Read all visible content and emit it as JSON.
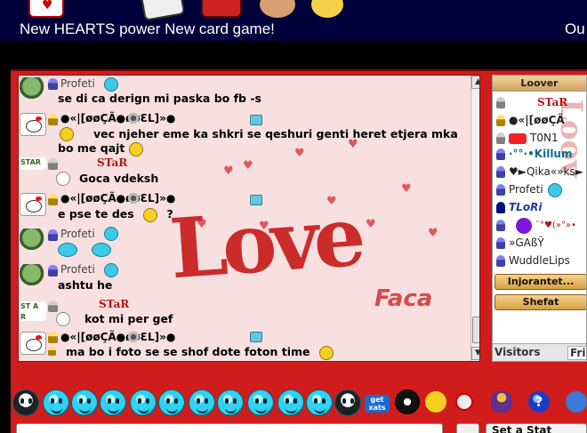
{
  "banner": {
    "text": "New HEARTS power New card game!",
    "text_right": "Ou"
  },
  "chat": {
    "background_text": "Love",
    "background_text2": "Faca",
    "messages": [
      {
        "name": "Profeti",
        "text": "se di ca derign mi paska bo fb -s"
      },
      {
        "name": "●«|[øøÇÃ●øøƐL]»●",
        "text": "vec njeher eme ka shkri se qeshuri genti heret etjera mka",
        "text2": "bo me qajt"
      },
      {
        "name": "STaR",
        "text": "Goca vdeksh"
      },
      {
        "name": "●«|[øøÇÃ●øøƐL]»●",
        "text": "e pse te des",
        "text_suffix": "?"
      },
      {
        "name": "Profeti",
        "text": ""
      },
      {
        "name": "Profeti",
        "text": "ashtu he"
      },
      {
        "name": "STaR",
        "text": "kot mi per gef"
      },
      {
        "name": "●«|[øøÇÃ●øøƐL]»●",
        "text": "ma bo i foto se se shof dote foton time"
      }
    ]
  },
  "userlist": {
    "header": "Loover",
    "users": [
      {
        "name": "STaR"
      },
      {
        "name": "●«|[øøÇÃ"
      },
      {
        "name": "T0N1"
      },
      {
        "name": "·°°·•Killum"
      },
      {
        "name": "♥►Qika«»ks►"
      },
      {
        "name": "Profeti"
      },
      {
        "name": "TLoRi"
      },
      {
        "name": "¨°♥(»°»•"
      },
      {
        "name": "»GAßŸ"
      },
      {
        "name": "WuddleLips"
      }
    ],
    "buttons": [
      "Injorantet...",
      "Shefat"
    ],
    "tabs": [
      "Visitors",
      "Frie"
    ]
  },
  "toolbar": {
    "get_xats": "get xats"
  },
  "input": {
    "status_label": "Set a Stat"
  }
}
